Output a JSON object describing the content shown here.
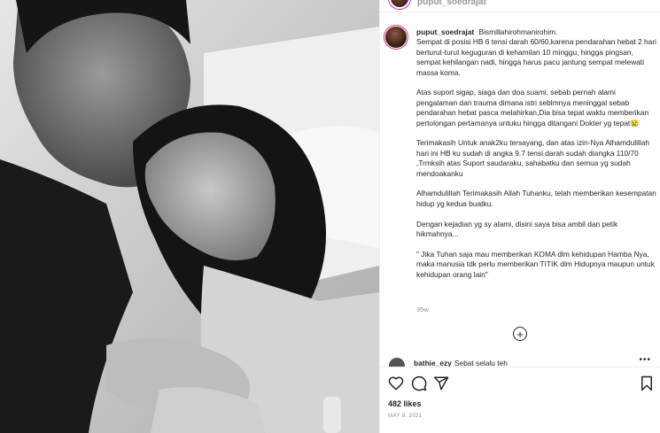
{
  "post": {
    "top_username": "puput_soedrajat",
    "username": "puput_soedrajat",
    "caption": [
      "Bismillahirohmanirohim.",
      "Sempat di posisi HB 6 tensi darah 60/60,karena pendarahan hebat 2 hari berturut-turut keguguran di kehamilan 10 minggu, hingga pingsan, sempat kehilangan nadi, hingga harus pacu jantung sempat melewati massa koma.",
      "Atas suport sigap, siaga dan doa suami, sebab pernah alami pengalaman dan trauma dimana istri seblmnya meninggal sebab pendarahan hebat pasca melahirkan,Dia bisa tepat waktu memberikan pertolongan pertamanya untuku hingga ditangani Dokter yg tepat😢",
      "Terimakasih Untuk anak2ku tersayang, dan atas izin-Nya Alhamdulillah hari ini HB ku sudah di angka 9.7 tensi darah sudah diangka 110/70 ,Trmksih atas Suport saudaraku, sahabatku dan semua yg sudah mendoakanku",
      "Alhamdulillah Terimakasih Allah Tuhanku, telah memberikan kesempatan hidup yg kedua buatku.",
      "Dengan kejadian yg sy alami, disini saya bisa ambil dan petik hikmahnya...",
      "\" Jika Tuhan saja mau memberikan KOMA dlm kehidupan Hamba Nya, maka manusia tdk perlu memberikan TITIK dlm Hidupnya maupun untuk kehidupan orang lain\""
    ],
    "time_ago": "35w",
    "more_comments_symbol": "+",
    "comment": {
      "username": "bathie_ezy",
      "text": "Sebat selalu teh",
      "more": "•••"
    },
    "likes": "482 likes",
    "date": "MAY 8, 2021"
  },
  "icons": {
    "like": "heart-icon",
    "comment": "comment-icon",
    "share": "share-icon",
    "save": "bookmark-icon",
    "more_comments": "plus-circle-icon"
  }
}
